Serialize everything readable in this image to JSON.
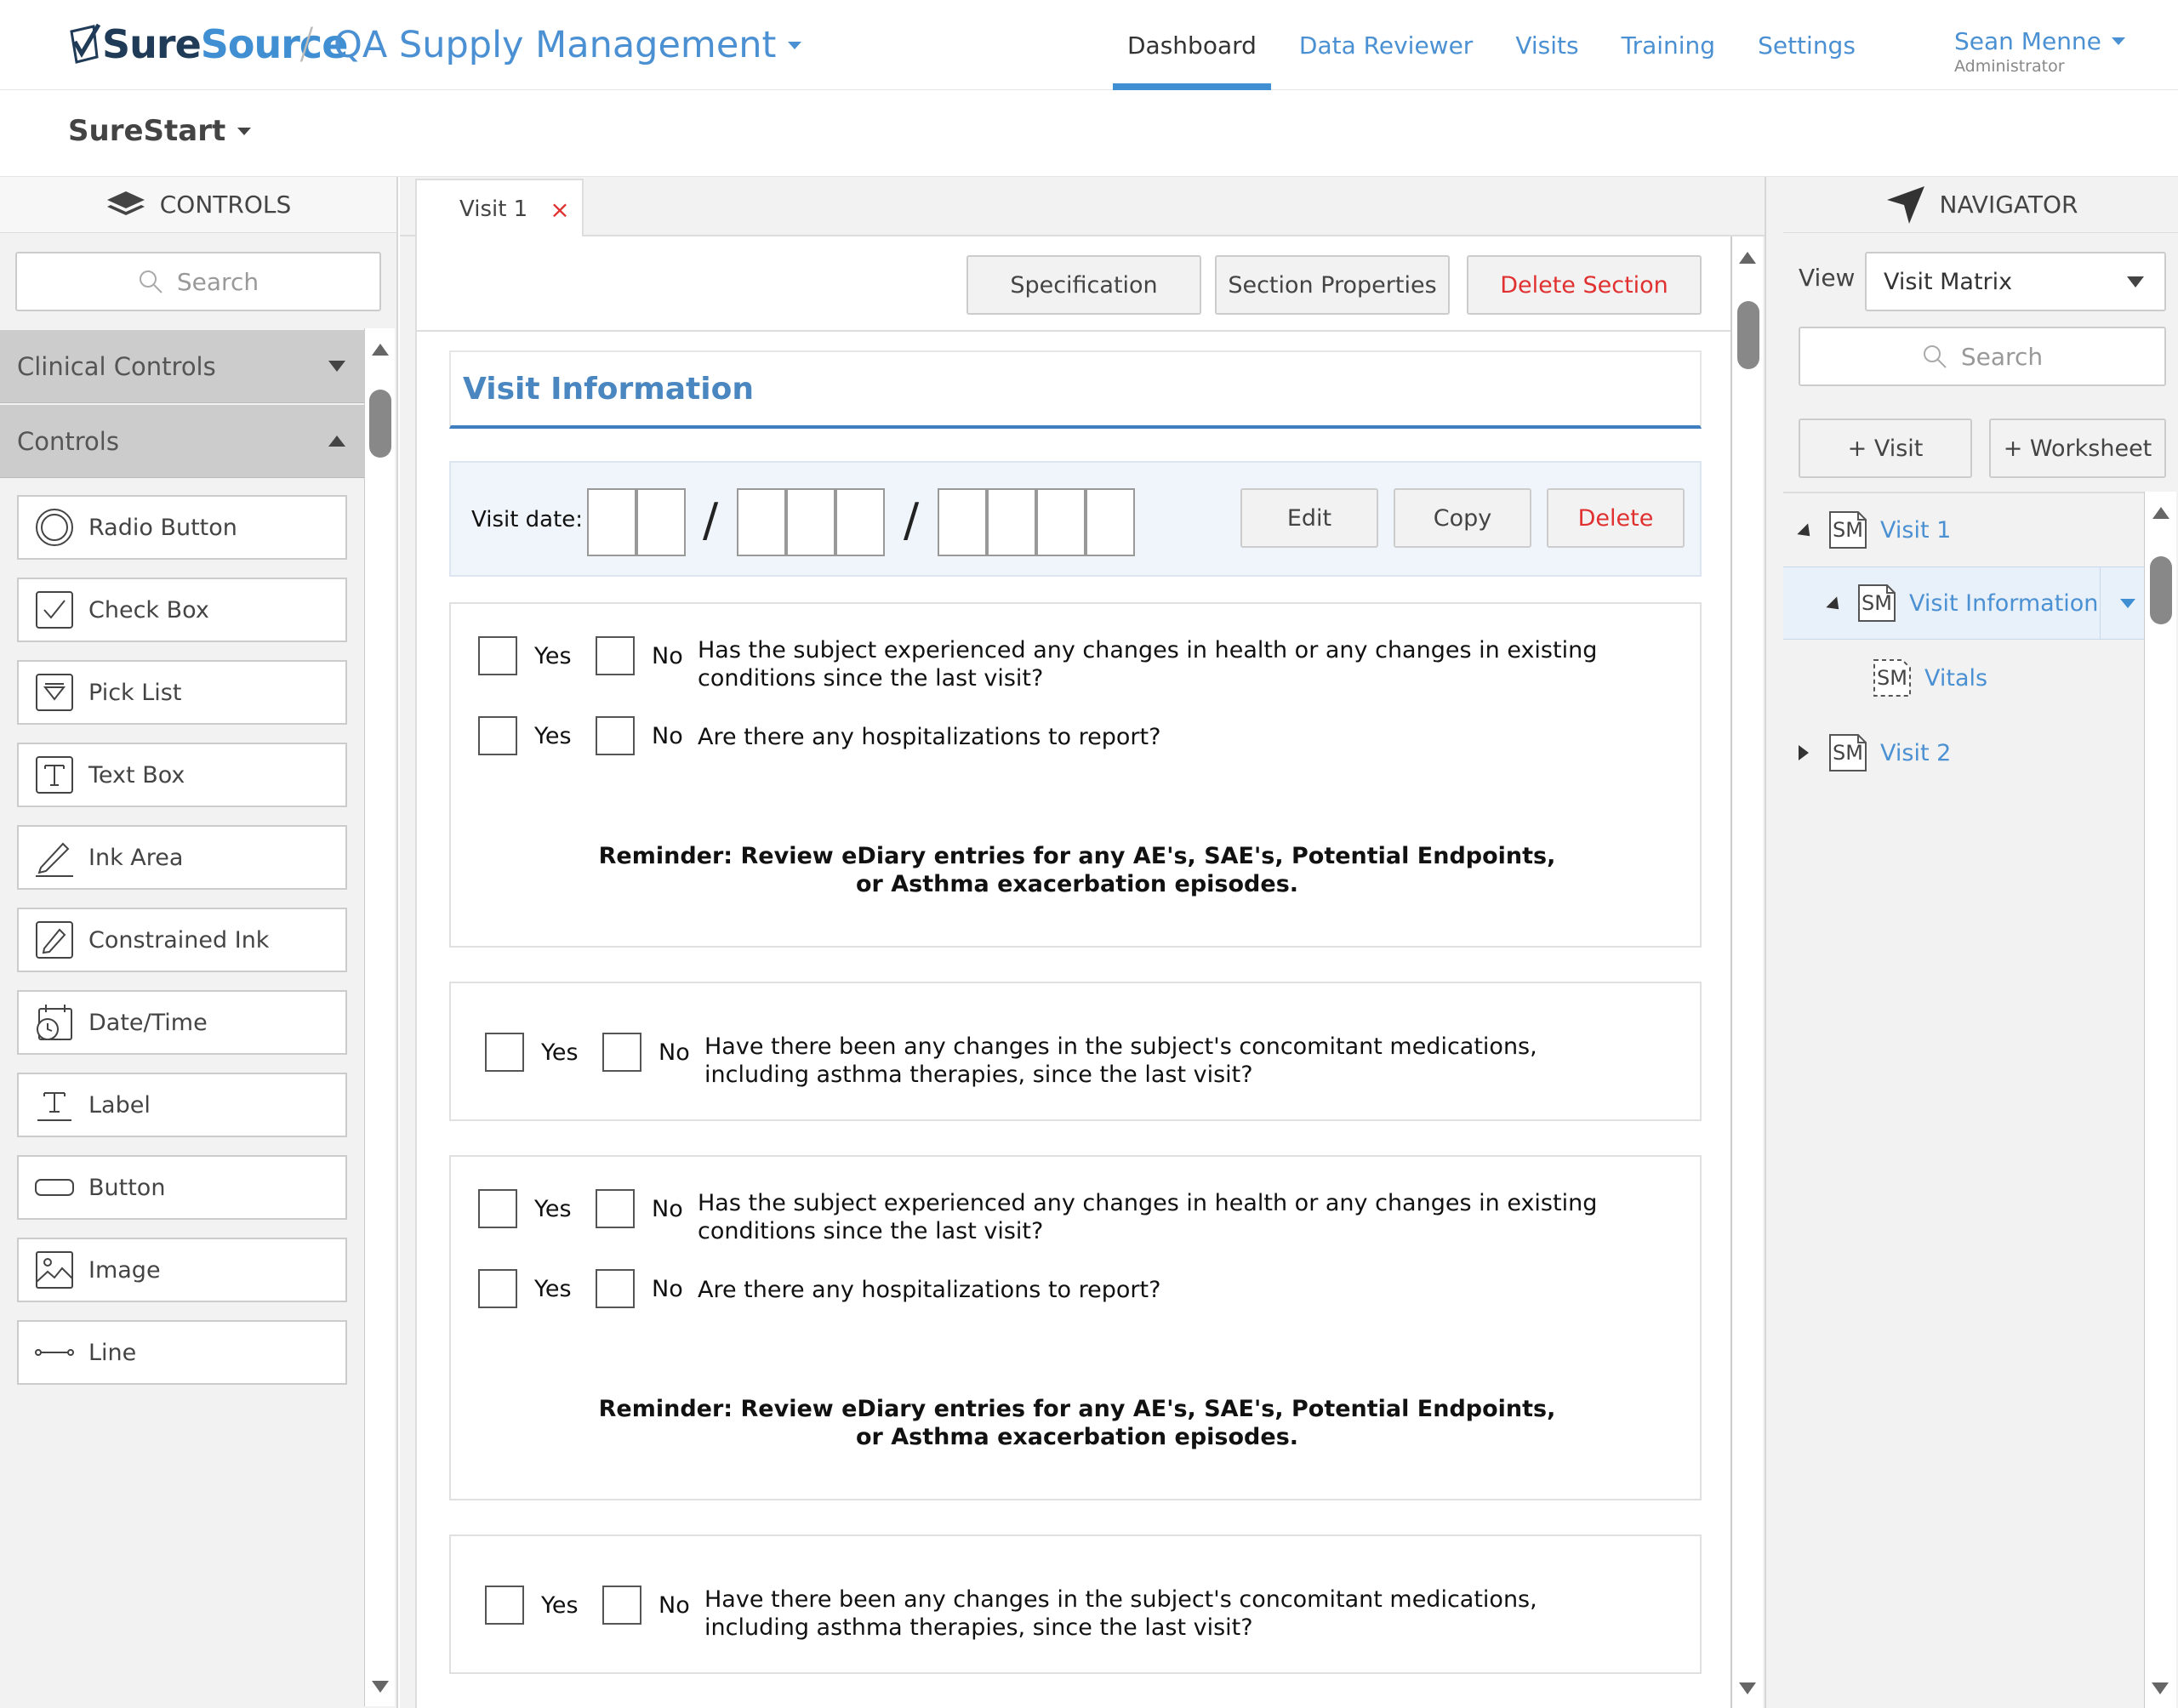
{
  "header": {
    "brand_part1": "Sure",
    "brand_part2": "Source",
    "separator": "/",
    "app_title": "QA Supply Management",
    "nav": [
      "Dashboard",
      "Data Reviewer",
      "Visits",
      "Training",
      "Settings"
    ],
    "active_nav": "Dashboard",
    "user_name": "Sean Menne",
    "user_role": "Administrator"
  },
  "subbar": {
    "project": "SureStart"
  },
  "controls_panel": {
    "title": "CONTROLS",
    "search_placeholder": "Search",
    "sections": [
      {
        "label": "Clinical Controls",
        "state": "collapsed"
      },
      {
        "label": "Controls",
        "state": "expanded"
      }
    ],
    "items": [
      {
        "label": "Radio Button",
        "icon": "radio-icon"
      },
      {
        "label": "Check Box",
        "icon": "checkbox-icon"
      },
      {
        "label": "Pick List",
        "icon": "picklist-icon"
      },
      {
        "label": "Text Box",
        "icon": "textbox-icon"
      },
      {
        "label": "Ink Area",
        "icon": "ink-area-icon"
      },
      {
        "label": "Constrained Ink",
        "icon": "constrained-ink-icon"
      },
      {
        "label": "Date/Time",
        "icon": "datetime-icon"
      },
      {
        "label": "Label",
        "icon": "label-icon"
      },
      {
        "label": "Button",
        "icon": "button-icon"
      },
      {
        "label": "Image",
        "icon": "image-icon"
      },
      {
        "label": "Line",
        "icon": "line-icon"
      }
    ]
  },
  "editor": {
    "tab": {
      "label": "Visit 1",
      "close": "×"
    },
    "toolbar": {
      "specification": "Specification",
      "section_properties": "Section Properties",
      "delete_section": "Delete Section"
    },
    "section_title": "Visit Information",
    "visit_date": {
      "label": "Visit date:",
      "slash": "/",
      "edit": "Edit",
      "copy": "Copy",
      "delete": "Delete"
    },
    "yes": "Yes",
    "no": "No",
    "questions": {
      "q_health": "Has the subject experienced any changes in health or any changes in existing conditions since the last visit?",
      "q_hosp": "Are there any hospitalizations to report?",
      "q_meds": "Have there been any changes in the subject's concomitant medications, including asthma therapies, since the last visit?"
    },
    "reminder": "Reminder:  Review eDiary entries for any AE's, SAE's, Potential Endpoints, or Asthma exacerbation episodes."
  },
  "navigator": {
    "title": "NAVIGATOR",
    "view_label": "View",
    "view_value": "Visit Matrix",
    "search_placeholder": "Search",
    "add_visit": "+ Visit",
    "add_worksheet": "+ Worksheet",
    "sm": "SM",
    "tree": [
      {
        "label": "Visit 1",
        "state": "expanded"
      },
      {
        "label": "Visit Information",
        "state": "expanded",
        "selected": true
      },
      {
        "label": "Vitals"
      },
      {
        "label": "Visit 2",
        "state": "collapsed"
      }
    ]
  },
  "colors": {
    "accent": "#3f8fd2",
    "danger": "#e03030",
    "panel_bg": "#f2f2f2"
  }
}
